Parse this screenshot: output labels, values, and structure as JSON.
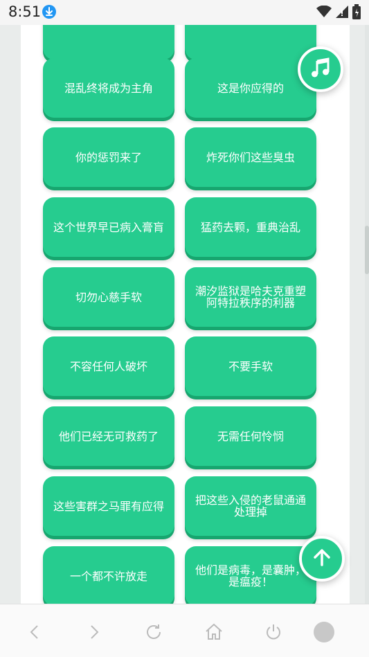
{
  "status_bar": {
    "time": "8:51"
  },
  "cards": [
    {
      "label": ""
    },
    {
      "label": ""
    },
    {
      "label": "混乱终将成为主角"
    },
    {
      "label": "这是你应得的"
    },
    {
      "label": "你的惩罚来了"
    },
    {
      "label": "炸死你们这些臭虫"
    },
    {
      "label": "这个世界早已病入膏肓"
    },
    {
      "label": "猛药去颗，重典治乱"
    },
    {
      "label": "切勿心慈手软"
    },
    {
      "label": "潮汐监狱是哈夫克重塑阿特拉秩序的利器"
    },
    {
      "label": "不容任何人破坏"
    },
    {
      "label": "不要手软"
    },
    {
      "label": "他们已经无可救药了"
    },
    {
      "label": "无需任何怜悯"
    },
    {
      "label": "这些害群之马罪有应得"
    },
    {
      "label": "把这些入侵的老鼠通通处理掉"
    },
    {
      "label": "一个都不许放走"
    },
    {
      "label": "他们是病毒，是囊肿，是瘟疫！"
    }
  ],
  "fabs": {
    "music_icon": "music-note-icon",
    "top_icon": "arrow-up-icon"
  },
  "colors": {
    "accent": "#26cc8f",
    "accent_shadow": "#17a66f",
    "background": "#e9eceb"
  }
}
